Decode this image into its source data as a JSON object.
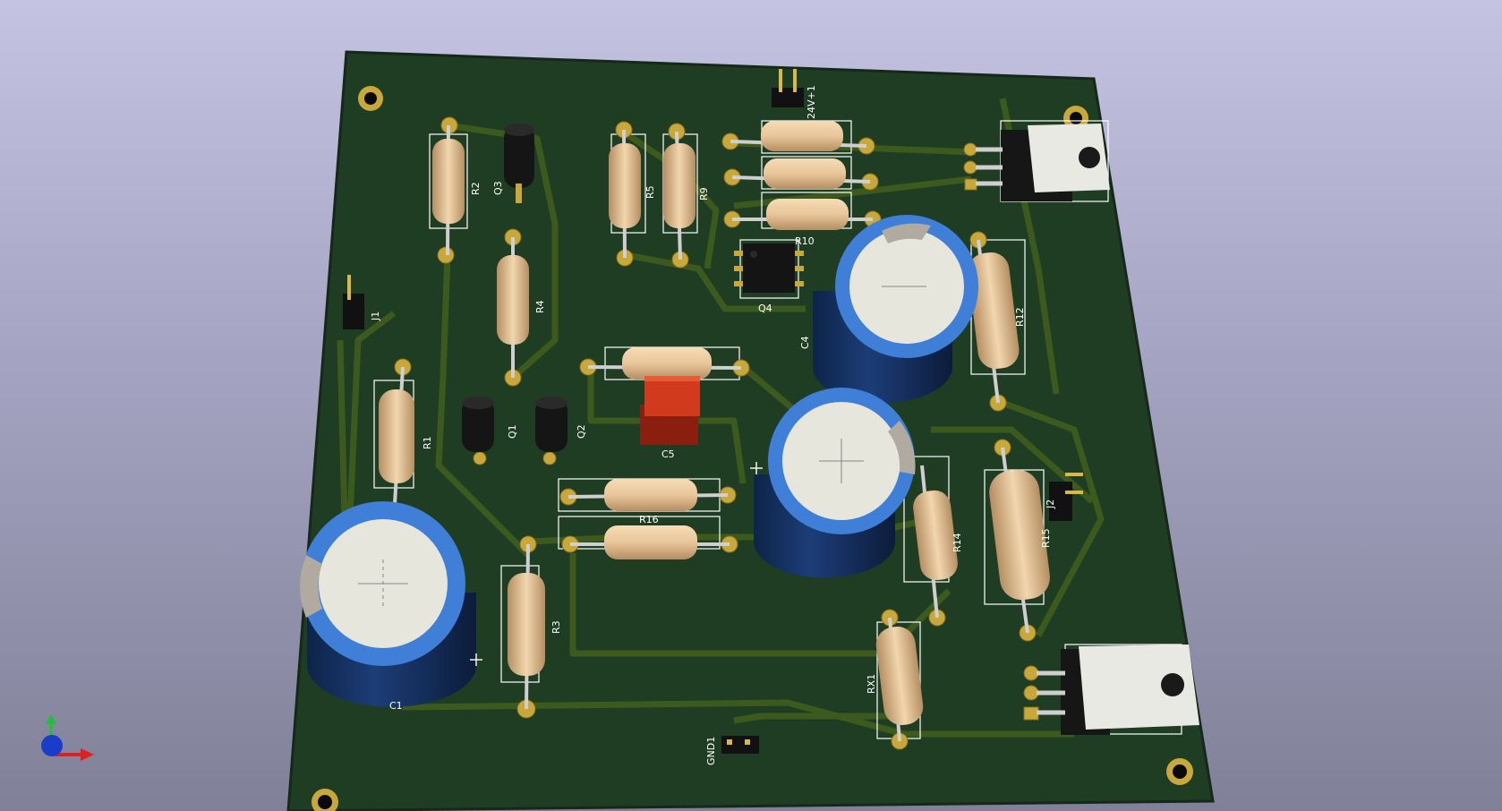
{
  "colors": {
    "board": "#1f3d22",
    "board_edge": "#15291a",
    "trace": "#3d5a1e",
    "pad": "#c8a83a",
    "resistor_body": "#e8c69a",
    "capacitor_blue": "#3f7fd8",
    "capacitor_top": "#e6e6dc",
    "film_cap": "#d23a1e",
    "silkscreen": "#ffffff"
  },
  "board": {
    "labels": {
      "r1": "R1",
      "r2": "R2",
      "r3": "R3",
      "r4": "R4",
      "r5": "R5",
      "r9": "R9",
      "r10": "R10",
      "r12": "R12",
      "r14": "R14",
      "r15": "R15",
      "r16": "R16",
      "rx1": "RX1",
      "q1": "Q1",
      "q2": "Q2",
      "q3": "Q3",
      "q4": "Q4",
      "c1": "C1",
      "c4": "C4",
      "c5": "C5",
      "j1": "J1",
      "j2": "J2",
      "gnd1": "GND1",
      "v24": "24V+1"
    }
  },
  "axis_icons": [
    "y-axis-arrow",
    "x-axis-arrow",
    "z-axis-sphere"
  ]
}
